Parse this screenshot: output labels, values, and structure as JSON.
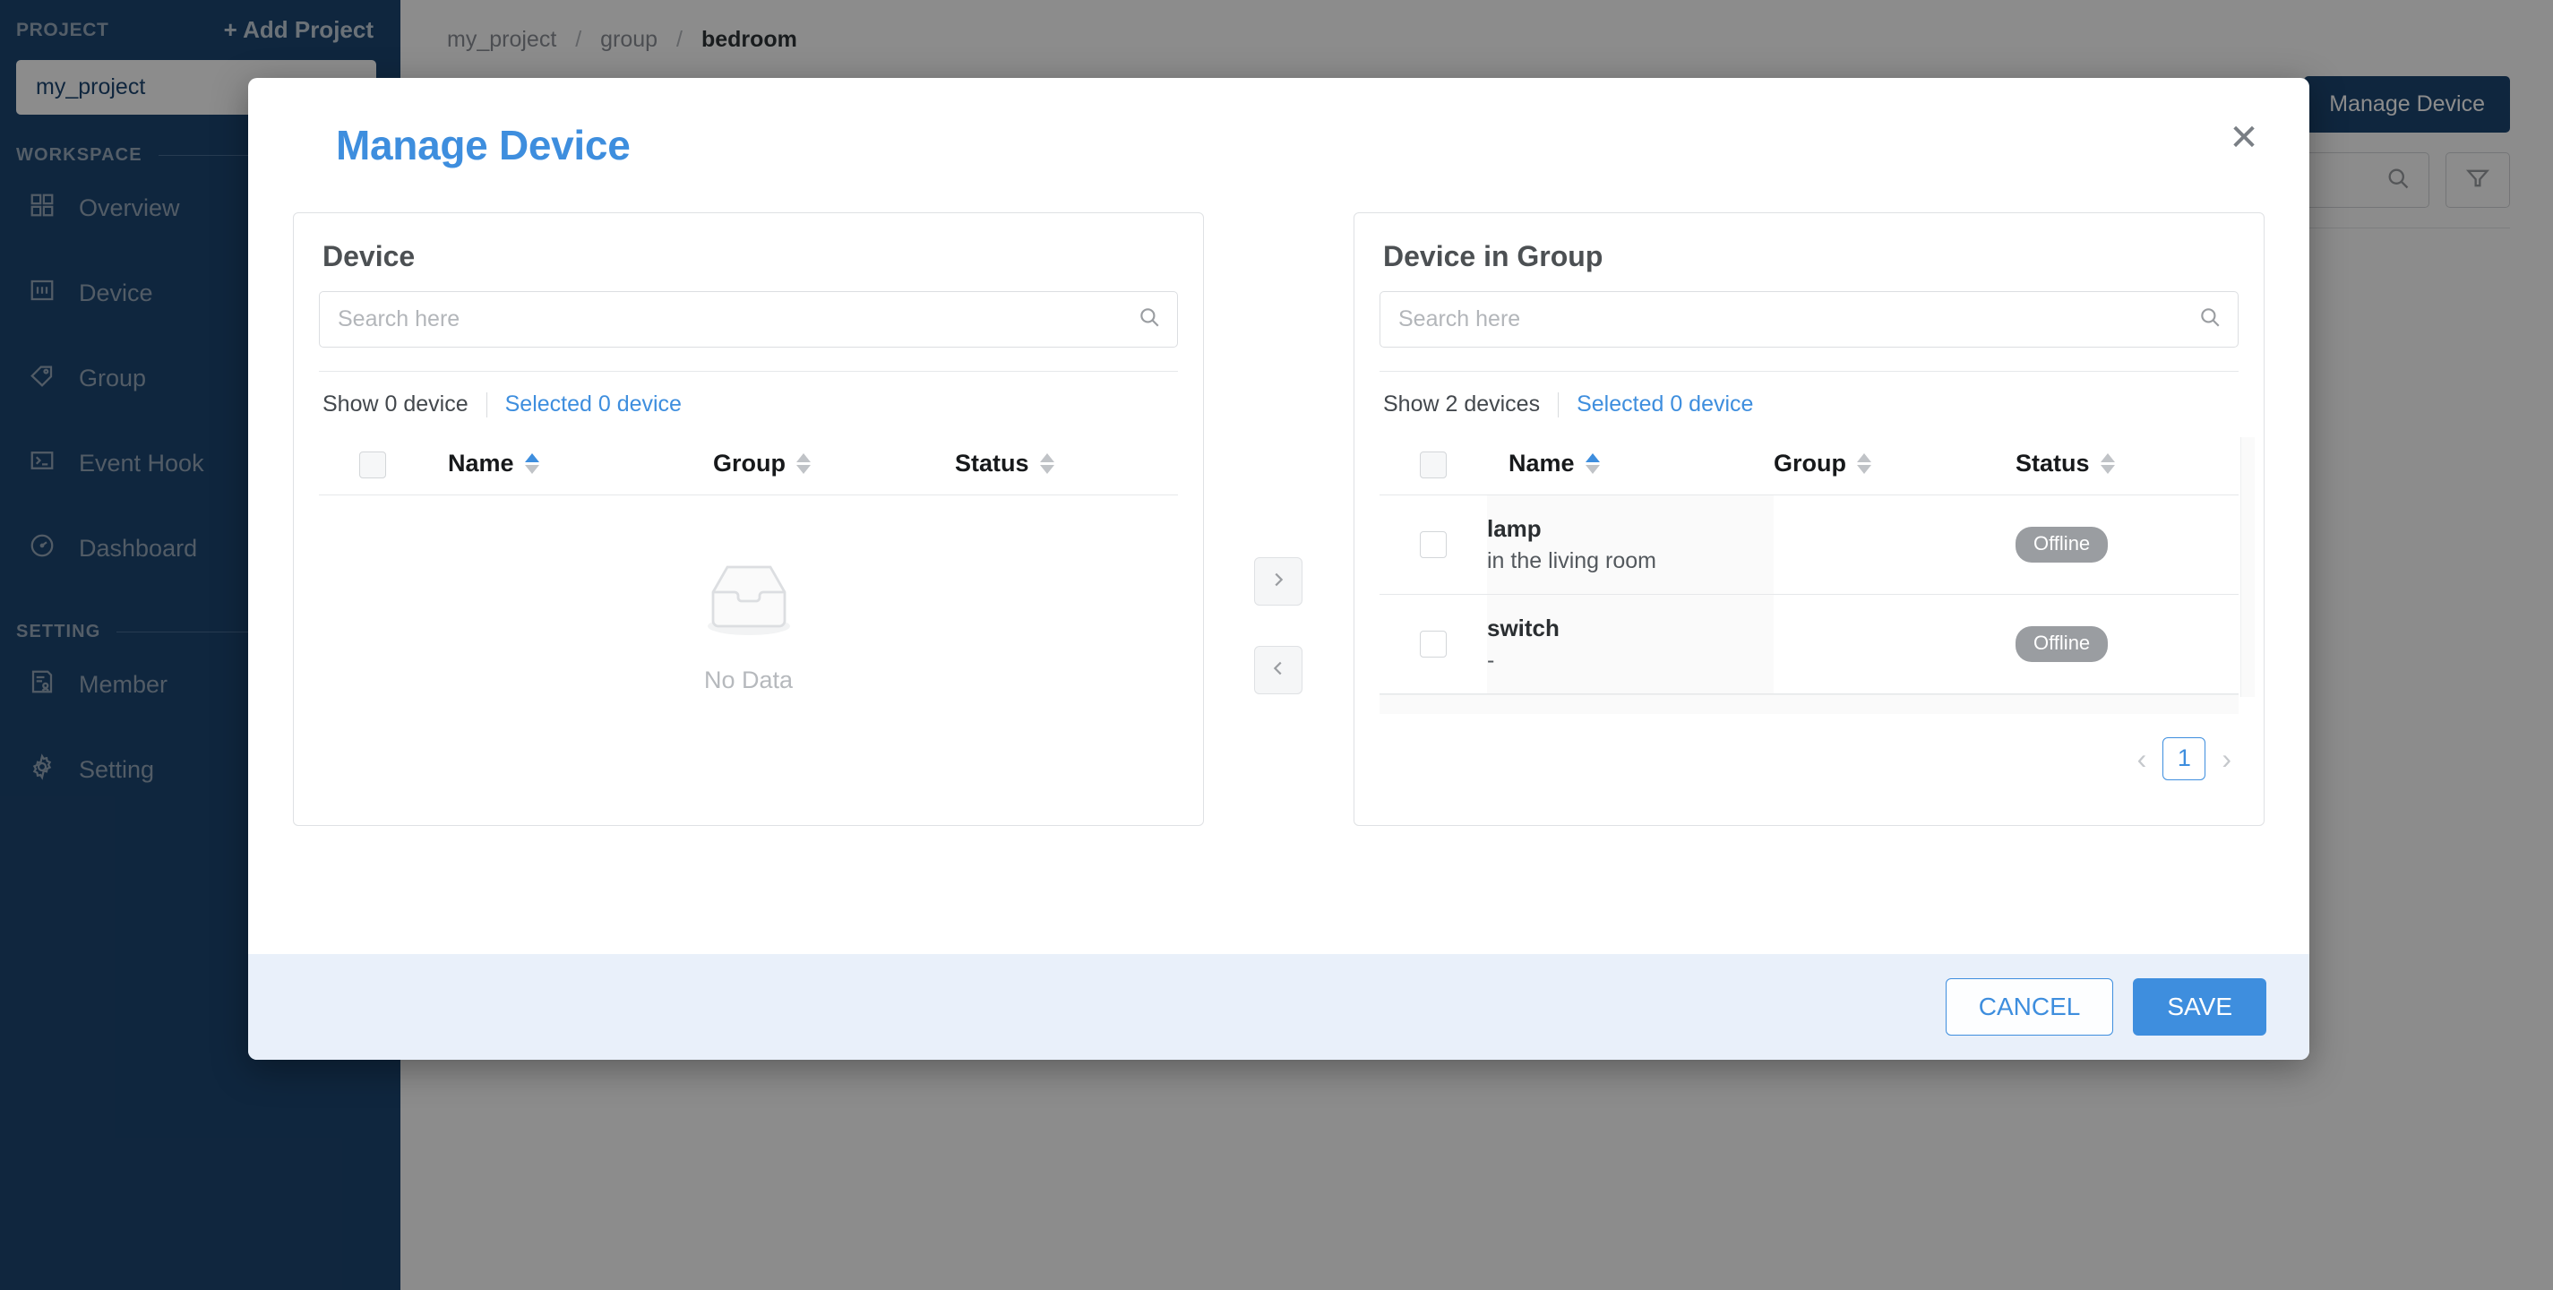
{
  "sidebar": {
    "project_label": "PROJECT",
    "add_project_label": "+ Add Project",
    "project_selected": "my_project",
    "sections": [
      {
        "label": "WORKSPACE"
      },
      {
        "label": "SETTING"
      }
    ],
    "workspace_items": [
      {
        "label": "Overview",
        "icon": "grid-icon"
      },
      {
        "label": "Device",
        "icon": "device-icon"
      },
      {
        "label": "Group",
        "icon": "tag-icon"
      },
      {
        "label": "Event Hook",
        "icon": "terminal-icon"
      },
      {
        "label": "Dashboard",
        "icon": "gauge-icon"
      }
    ],
    "setting_items": [
      {
        "label": "Member",
        "icon": "member-icon"
      },
      {
        "label": "Setting",
        "icon": "gear-icon"
      }
    ]
  },
  "background": {
    "breadcrumb": [
      {
        "label": "my_project",
        "current": false
      },
      {
        "label": "group",
        "current": false
      },
      {
        "label": "bedroom",
        "current": true
      }
    ],
    "breadcrumb_separator": "/",
    "manage_device_button": "Manage Device",
    "search_placeholder": "",
    "filter_icon": "filter-icon",
    "search_icon": "search-icon"
  },
  "modal": {
    "title": "Manage Device",
    "close_icon": "close-icon",
    "left_panel": {
      "title": "Device",
      "search_placeholder": "Search here",
      "search_value": "",
      "search_icon": "search-icon",
      "show_count_text": "Show 0 device",
      "selected_count_text": "Selected 0 device",
      "columns": [
        {
          "label": "Name",
          "sort": "asc"
        },
        {
          "label": "Group",
          "sort": "none"
        },
        {
          "label": "Status",
          "sort": "none"
        }
      ],
      "rows": [],
      "empty_text": "No Data",
      "empty_icon": "inbox-icon"
    },
    "right_panel": {
      "title": "Device in Group",
      "search_placeholder": "Search here",
      "search_value": "",
      "search_icon": "search-icon",
      "show_count_text": "Show 2 devices",
      "selected_count_text": "Selected 0 device",
      "columns": [
        {
          "label": "Name",
          "sort": "asc"
        },
        {
          "label": "Group",
          "sort": "none"
        },
        {
          "label": "Status",
          "sort": "none"
        }
      ],
      "rows": [
        {
          "name": "lamp",
          "desc": "in the living room",
          "group": "",
          "status": "Offline"
        },
        {
          "name": "switch",
          "desc": "-",
          "group": "",
          "status": "Offline"
        }
      ],
      "pagination": {
        "prev_icon": "chevron-left-icon",
        "next_icon": "chevron-right-icon",
        "current_page": "1"
      }
    },
    "transfer": {
      "to_right_icon": "chevron-right-icon",
      "to_left_icon": "chevron-left-icon"
    },
    "footer": {
      "cancel_label": "CANCEL",
      "save_label": "SAVE"
    }
  },
  "colors": {
    "sidebar_bg": "#1d4571",
    "accent_blue": "#3e8ede",
    "footer_bg": "#e9f0fa",
    "badge_gray": "#9a9da1"
  }
}
